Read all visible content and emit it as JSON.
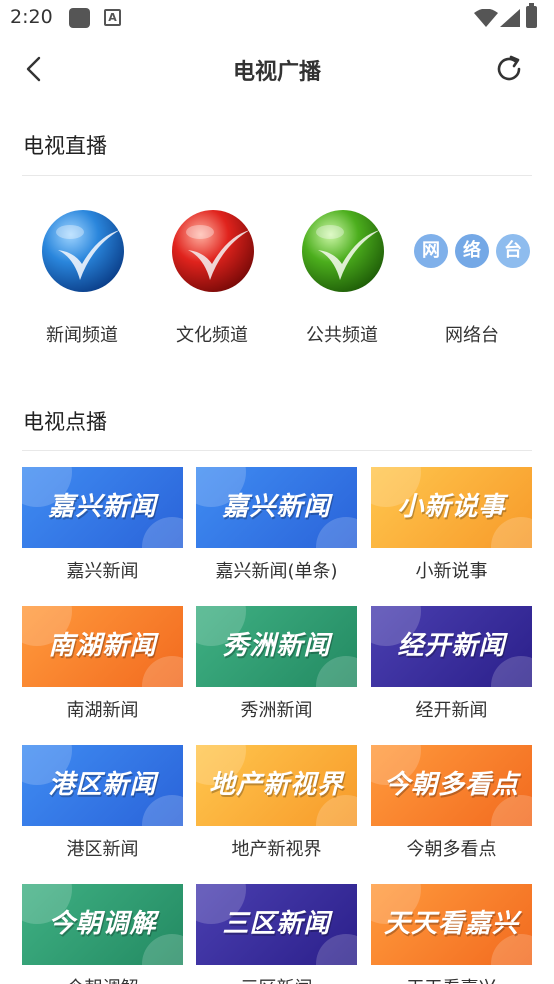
{
  "status_bar": {
    "time": "2:20"
  },
  "header": {
    "title": "电视广播"
  },
  "live": {
    "title": "电视直播",
    "items": [
      {
        "label": "新闻频道",
        "color": "#1f7ad8"
      },
      {
        "label": "文化频道",
        "color": "#d81f1f"
      },
      {
        "label": "公共频道",
        "color": "#4aa51e"
      },
      {
        "label": "网络台",
        "logo_chars": [
          "网",
          "络",
          "台"
        ],
        "color": "#8cb8ec"
      }
    ]
  },
  "vod": {
    "title": "电视点播",
    "items": [
      {
        "thumb_title": "嘉兴新闻",
        "label": "嘉兴新闻",
        "theme": "blue"
      },
      {
        "thumb_title": "嘉兴新闻",
        "label": "嘉兴新闻(单条)",
        "theme": "blue"
      },
      {
        "thumb_title": "小新说事",
        "label": "小新说事",
        "theme": "yellow"
      },
      {
        "thumb_title": "南湖新闻",
        "label": "南湖新闻",
        "theme": "orange"
      },
      {
        "thumb_title": "秀洲新闻",
        "label": "秀洲新闻",
        "theme": "green"
      },
      {
        "thumb_title": "经开新闻",
        "label": "经开新闻",
        "theme": "purple"
      },
      {
        "thumb_title": "港区新闻",
        "label": "港区新闻",
        "theme": "blue"
      },
      {
        "thumb_title": "地产新视界",
        "label": "地产新视界",
        "theme": "yellow"
      },
      {
        "thumb_title": "今朝多看点",
        "label": "今朝多看点",
        "theme": "orange"
      },
      {
        "thumb_title": "今朝调解",
        "label": "今朝调解",
        "theme": "green"
      },
      {
        "thumb_title": "三区新闻",
        "label": "三区新闻",
        "theme": "purple"
      },
      {
        "thumb_title": "天天看嘉兴",
        "label": "天天看嘉兴",
        "theme": "orange"
      }
    ]
  }
}
